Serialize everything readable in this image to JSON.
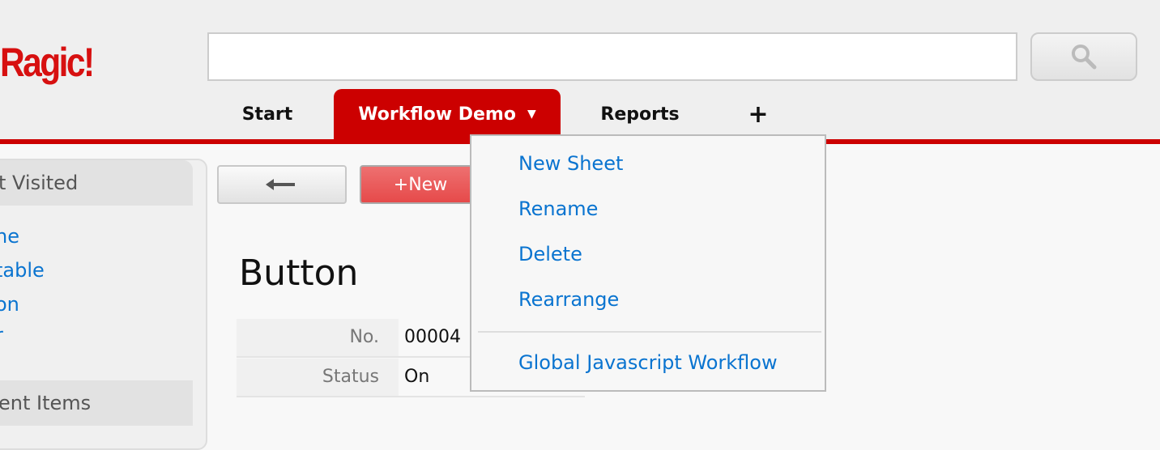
{
  "header": {
    "logo": "Ragic!",
    "search_placeholder": "",
    "search_icon": "magnifier-icon"
  },
  "tabs": [
    {
      "label": "Start"
    },
    {
      "label": "Workflow Demo",
      "active": true
    },
    {
      "label": "Reports"
    },
    {
      "label": "+"
    }
  ],
  "sidebar": {
    "sections": [
      {
        "title": "t Visited",
        "items": [
          "ne",
          "table",
          "on",
          "r"
        ]
      },
      {
        "title": "ent Items"
      }
    ]
  },
  "toolbar": {
    "back_icon": "left-arrow-icon",
    "new_label": "+New"
  },
  "record": {
    "title": "Button",
    "fields": [
      {
        "label": "No.",
        "value": "00004"
      },
      {
        "label": "Status",
        "value": "On"
      }
    ]
  },
  "dropdown": {
    "items": [
      "New Sheet",
      "Rename",
      "Delete",
      "Rearrange"
    ],
    "extra": "Global Javascript Workflow"
  },
  "colors": {
    "brand": "#cc0000",
    "link": "#0a74d0"
  }
}
